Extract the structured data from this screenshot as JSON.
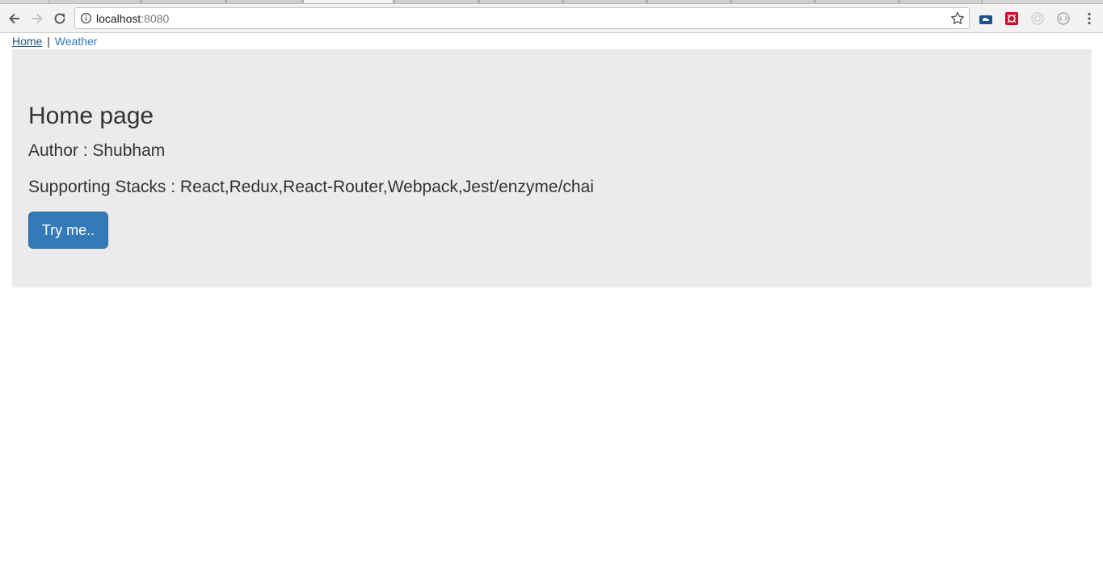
{
  "browser": {
    "url_host": "localhost",
    "url_port": ":8080",
    "icons": {
      "back": "back-arrow-icon",
      "forward": "forward-arrow-icon",
      "reload": "reload-icon",
      "info": "info-icon",
      "bookmark": "star-icon",
      "menu": "kebab-menu-icon"
    }
  },
  "nav": {
    "home_label": "Home",
    "separator": "|",
    "weather_label": "Weather"
  },
  "main": {
    "title": "Home page",
    "author": "Author : Shubham",
    "stacks": "Supporting Stacks : React,Redux,React-Router,Webpack,Jest/enzyme/chai",
    "button_label": "Try me.."
  },
  "colors": {
    "link": "#337ab7",
    "jumbotron_bg": "#ebebeb",
    "button_bg": "#337ab7",
    "text": "#333333"
  }
}
